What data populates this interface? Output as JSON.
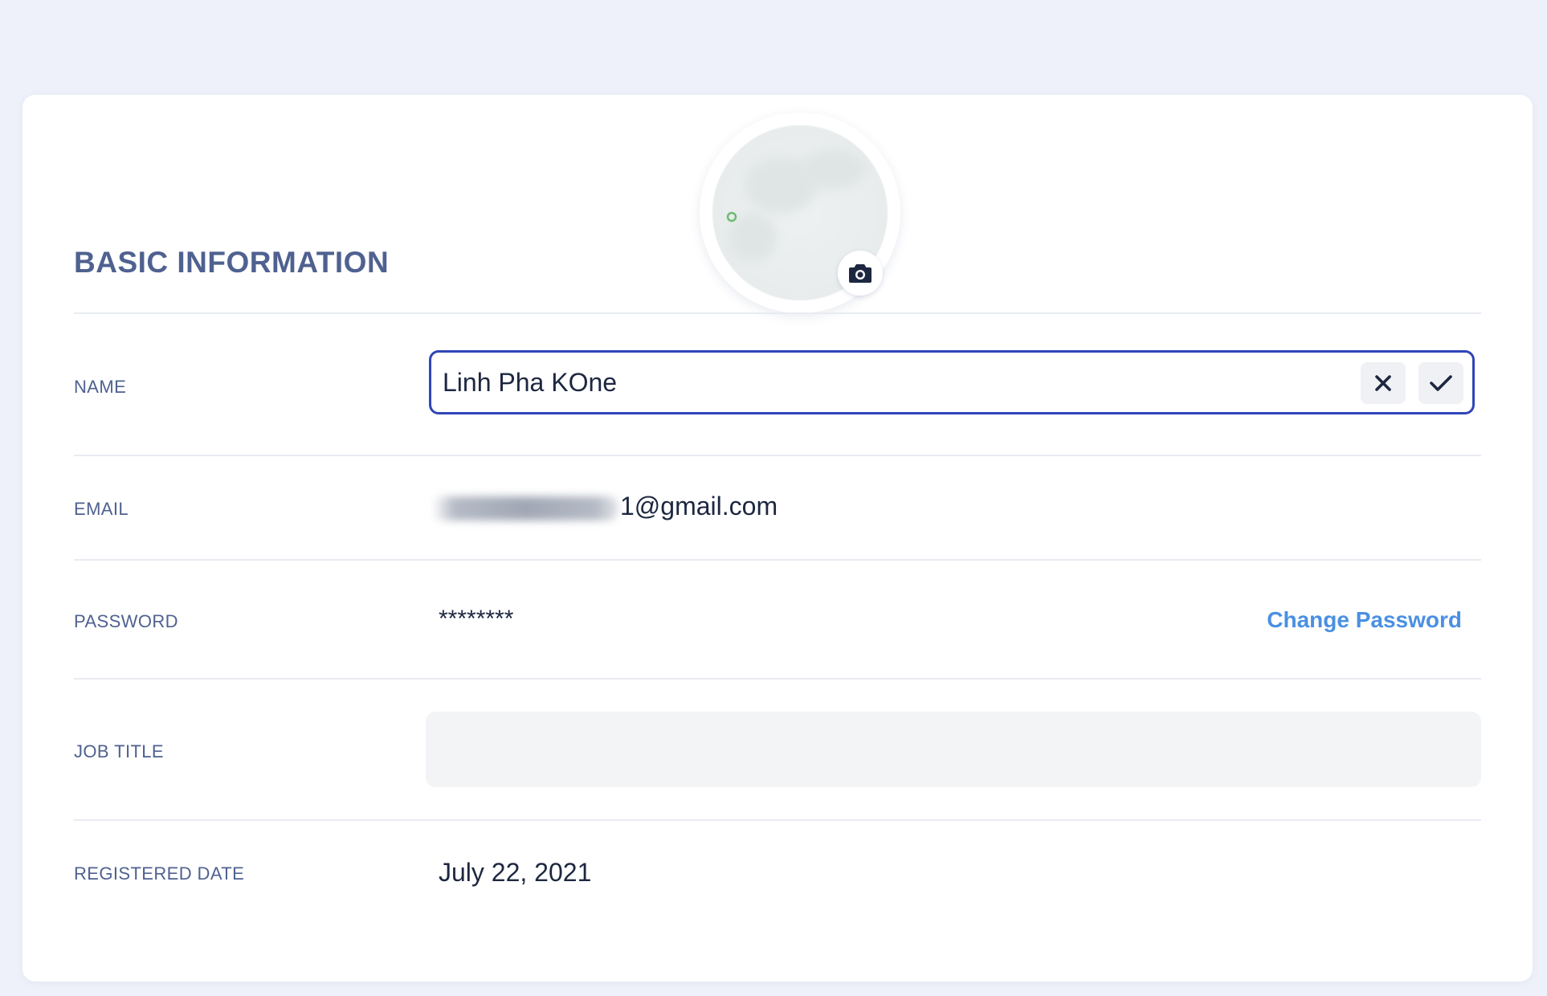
{
  "section": {
    "title": "BASIC INFORMATION"
  },
  "avatar": {
    "camera_icon": "camera-icon"
  },
  "fields": {
    "name": {
      "label": "NAME",
      "value": "Linh Pha KOne",
      "cancel_icon": "close-icon",
      "confirm_icon": "check-icon"
    },
    "email": {
      "label": "EMAIL",
      "value_visible": "1@gmail.com"
    },
    "password": {
      "label": "PASSWORD",
      "value": "********",
      "change_link": "Change Password"
    },
    "job_title": {
      "label": "JOB TITLE",
      "value": ""
    },
    "registered_date": {
      "label": "REGISTERED DATE",
      "value": "July 22, 2021"
    }
  },
  "colors": {
    "background": "#eef1fa",
    "card": "#ffffff",
    "label": "#4f6190",
    "text": "#1d2740",
    "accent_border": "#2f45b8",
    "link": "#4a90e2",
    "input_fill": "#f3f4f6"
  }
}
